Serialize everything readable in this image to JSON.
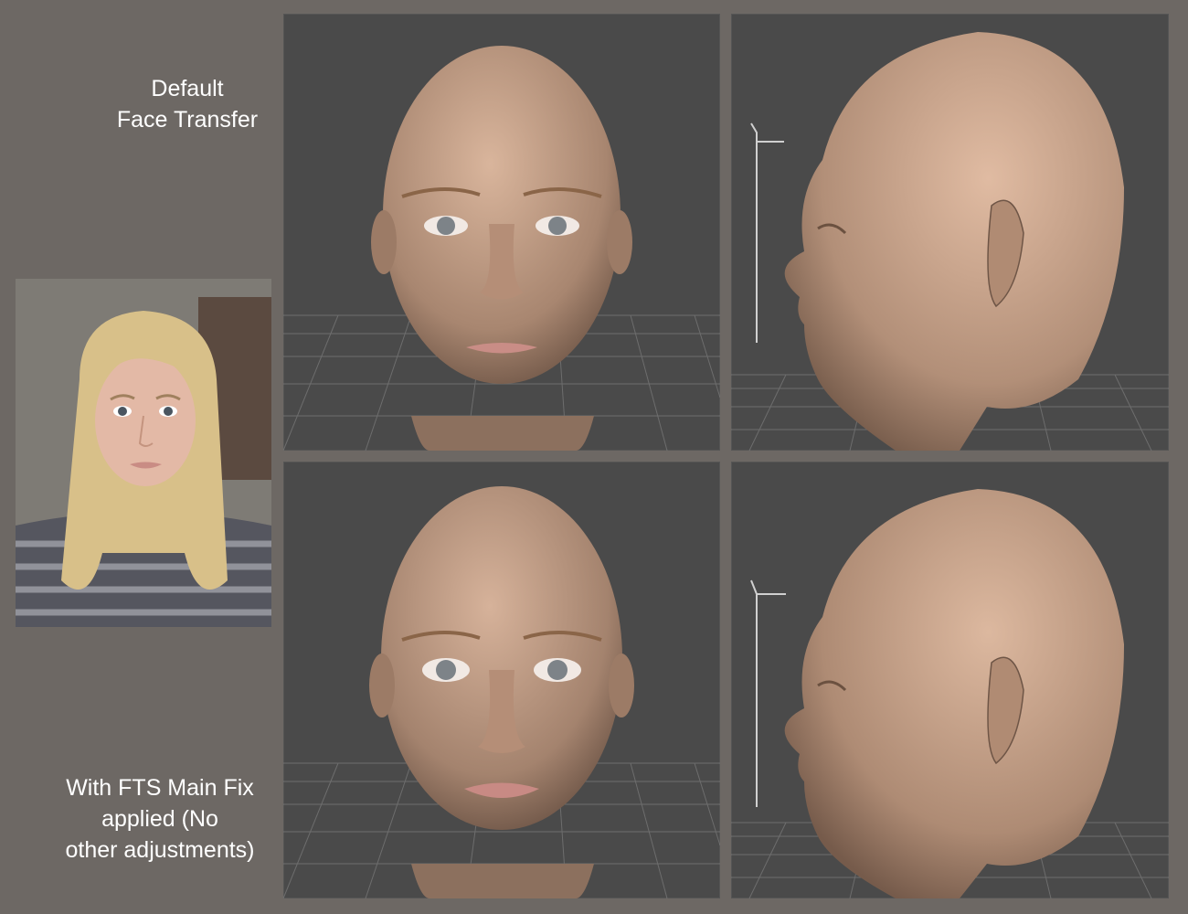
{
  "captions": {
    "default_line1": "Default",
    "default_line2": "Face Transfer",
    "fix_line1": "With FTS Main Fix",
    "fix_line2": "applied (No",
    "fix_line3": "other adjustments)"
  },
  "colors": {
    "background": "#6d6864",
    "viewport": "#4a4a4a",
    "skin": "#c9a48a"
  }
}
